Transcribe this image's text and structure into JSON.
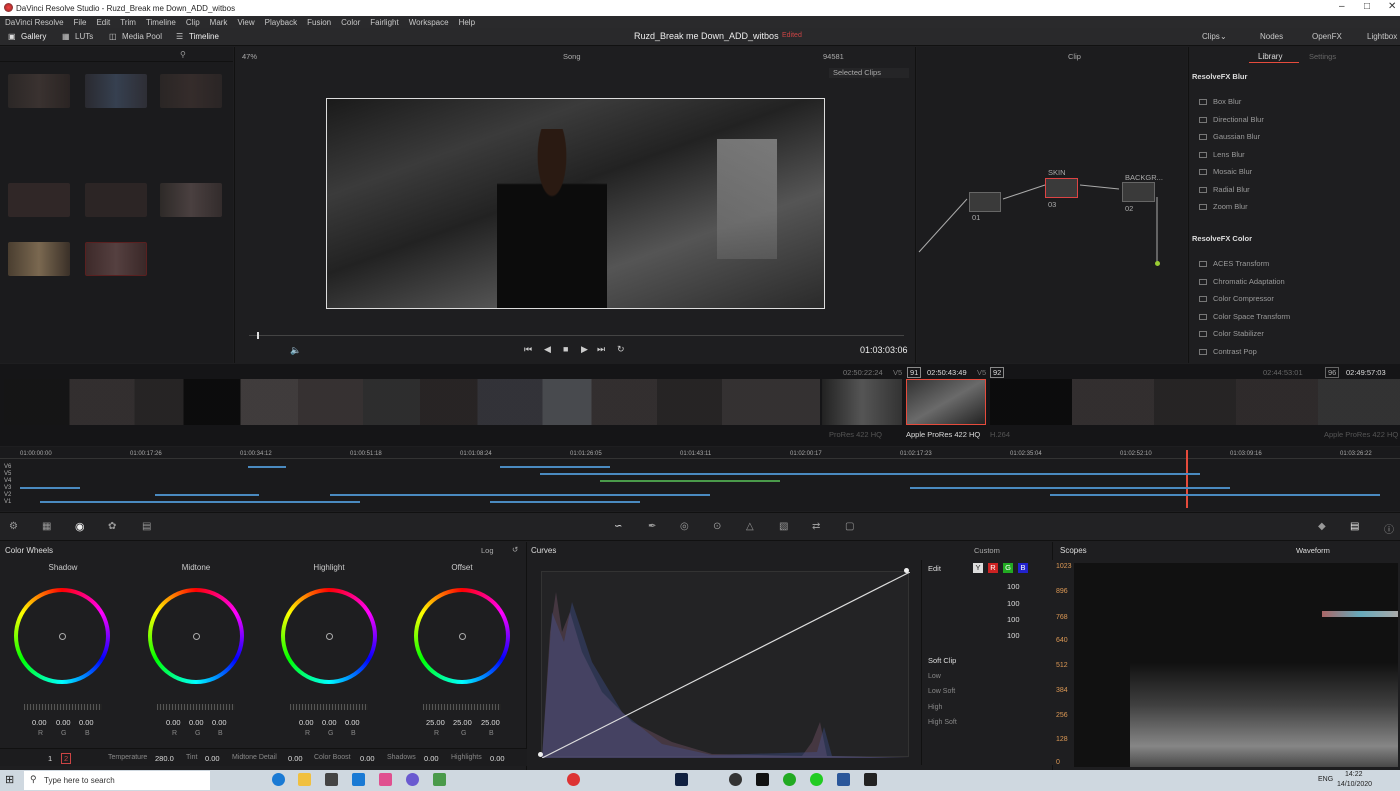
{
  "window": {
    "title": "DaVinci Resolve Studio - Ruzd_Break me Down_ADD_witbos"
  },
  "menu": [
    "DaVinci Resolve",
    "File",
    "Edit",
    "Trim",
    "Timeline",
    "Clip",
    "Mark",
    "View",
    "Playback",
    "Fusion",
    "Color",
    "Fairlight",
    "Workspace",
    "Help"
  ],
  "topbar": {
    "gallery": "Gallery",
    "luts": "LUTs",
    "media_pool": "Media Pool",
    "timeline": "Timeline",
    "project": "Ruzd_Break me Down_ADD_witbos",
    "edited": "Edited",
    "clips": "Clips",
    "nodes": "Nodes",
    "openfx": "OpenFX",
    "lightbox": "Lightbox"
  },
  "viewer": {
    "zoom": "47%",
    "timeline_name": "Song",
    "frame": "94581",
    "selected": "Selected Clips",
    "timecode": "01:03:03:06"
  },
  "nodes": {
    "mode": "Clip",
    "n1": "01",
    "n2": "SKIN",
    "n2id": "03",
    "n3": "BACKGR...",
    "n3id": "02"
  },
  "library": {
    "tab": "Library",
    "settings": "Settings",
    "blur_header": "ResolveFX Blur",
    "blur": [
      "Box Blur",
      "Directional Blur",
      "Gaussian Blur",
      "Lens Blur",
      "Mosaic Blur",
      "Radial Blur",
      "Zoom Blur"
    ],
    "color_header": "ResolveFX Color",
    "color": [
      "ACES Transform",
      "Chromatic Adaptation",
      "Color Compressor",
      "Color Space Transform",
      "Color Stabilizer",
      "Contrast Pop"
    ]
  },
  "cliprow": {
    "tc1": "02:50:22:24",
    "v5": "V5",
    "n91": "91",
    "tc2": "02:50:43:49",
    "v5b": "V5",
    "n92": "92",
    "tc3": "02:44:53:01",
    "n96": "96",
    "tc4": "02:49:57:03",
    "codec_prev": "ProRes 422 HQ",
    "codec": "Apple ProRes 422 HQ",
    "codec_next": "H.264",
    "codec_end": "Apple ProRes 422 HQ"
  },
  "ruler": [
    "01:00:00:00",
    "01:00:17:26",
    "01:00:34:12",
    "01:00:51:18",
    "01:01:08:24",
    "01:01:26:05",
    "01:01:43:11",
    "01:02:00:17",
    "01:02:17:23",
    "01:02:35:04",
    "01:02:52:10",
    "01:03:09:16",
    "01:03:26:22"
  ],
  "tracks": [
    "V6",
    "V5",
    "V4",
    "V3",
    "V2",
    "V1"
  ],
  "wheels": {
    "title": "Color Wheels",
    "mode": "Log",
    "items": [
      {
        "name": "Shadow",
        "r": "0.00",
        "g": "0.00",
        "b": "0.00"
      },
      {
        "name": "Midtone",
        "r": "0.00",
        "g": "0.00",
        "b": "0.00"
      },
      {
        "name": "Highlight",
        "r": "0.00",
        "g": "0.00",
        "b": "0.00"
      },
      {
        "name": "Offset",
        "r": "25.00",
        "g": "25.00",
        "b": "25.00"
      }
    ],
    "rgb": [
      "R",
      "G",
      "B"
    ]
  },
  "bottom": {
    "p1": "1",
    "p2": "2",
    "temperature_label": "Temperature",
    "temperature": "280.0",
    "tint_label": "Tint",
    "tint": "0.00",
    "md_label": "Midtone Detail",
    "md": "0.00",
    "cb_label": "Color Boost",
    "cb": "0.00",
    "sh_label": "Shadows",
    "sh": "0.00",
    "hl_label": "Highlights",
    "hl": "0.00"
  },
  "curves": {
    "title": "Curves",
    "mode": "Custom",
    "edit": "Edit",
    "y": "Y",
    "r": "R",
    "g": "G",
    "b": "B",
    "vals": [
      "100",
      "100",
      "100",
      "100"
    ],
    "softclip": "Soft Clip",
    "low": "Low",
    "lowsoft": "Low Soft",
    "high": "High",
    "highsoft": "High Soft"
  },
  "scopes": {
    "title": "Scopes",
    "mode": "Waveform",
    "ticks": [
      "1023",
      "896",
      "768",
      "640",
      "512",
      "384",
      "256",
      "128",
      "0"
    ]
  },
  "taskbar": {
    "search": "Type here to search",
    "lang": "ENG",
    "time": "14:22",
    "date": "14/10/2020"
  },
  "colors": {
    "accent": "#e64b3c",
    "blue": "#4a8ac0"
  }
}
